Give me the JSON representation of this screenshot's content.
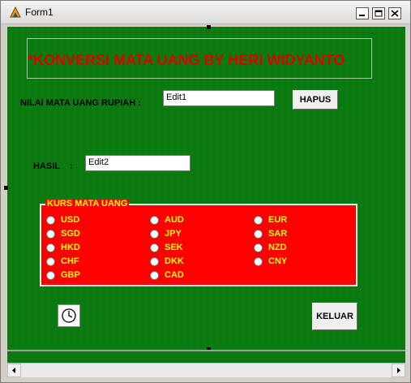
{
  "window": {
    "title": "Form1"
  },
  "header": {
    "title": "*KONVERSI MATA UANG BY HERI WIDYANTO"
  },
  "input": {
    "label": "NILAI MATA UANG RUPIAH :",
    "value": "Edit1"
  },
  "buttons": {
    "hapus": "HAPUS",
    "keluar": "KELUAR"
  },
  "result": {
    "label": "HASIL    :",
    "value": "Edit2"
  },
  "kurs": {
    "title": "KURS MATA UANG",
    "options": [
      "USD",
      "SGD",
      "HKD",
      "CHF",
      "GBP",
      "AUD",
      "JPY",
      "SEK",
      "DKK",
      "CAD",
      "EUR",
      "SAR",
      "NZD",
      "CNY"
    ]
  },
  "colors": {
    "form_bg": "#0a7a10",
    "title_red": "#e00000",
    "group_bg": "#ff0000",
    "group_text": "#ffff00"
  },
  "icons": {
    "timer": "clock-icon"
  }
}
